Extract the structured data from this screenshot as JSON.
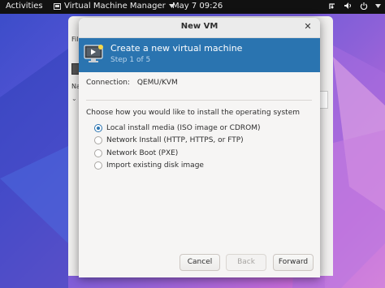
{
  "topbar": {
    "activities": "Activities",
    "app_name": "Virtual Machine Manager",
    "clock": "May 7  09:26"
  },
  "bg_window": {
    "menu_fragment": "Fil",
    "label_fragment": "Na"
  },
  "dialog": {
    "title": "New VM",
    "header_title": "Create a new virtual machine",
    "header_step": "Step 1 of 5",
    "connection_label": "Connection:",
    "connection_value": "QEMU/KVM",
    "question": "Choose how you would like to install the operating system",
    "options": [
      {
        "label": "Local install media (ISO image or CDROM)",
        "selected": true
      },
      {
        "label": "Network Install (HTTP, HTTPS, or FTP)",
        "selected": false
      },
      {
        "label": "Network Boot (PXE)",
        "selected": false
      },
      {
        "label": "Import existing disk image",
        "selected": false
      }
    ],
    "buttons": {
      "cancel": "Cancel",
      "back": "Back",
      "forward": "Forward"
    }
  },
  "colors": {
    "header_bg": "#2a74b0",
    "topbar_bg": "#111111",
    "dialog_bg": "#f6f5f4"
  },
  "icons": {
    "app_menu": "chevron-down-icon",
    "network": "network-icon",
    "volume": "volume-icon",
    "power": "power-icon",
    "close": "close-icon",
    "header": "vm-monitor-icon"
  }
}
